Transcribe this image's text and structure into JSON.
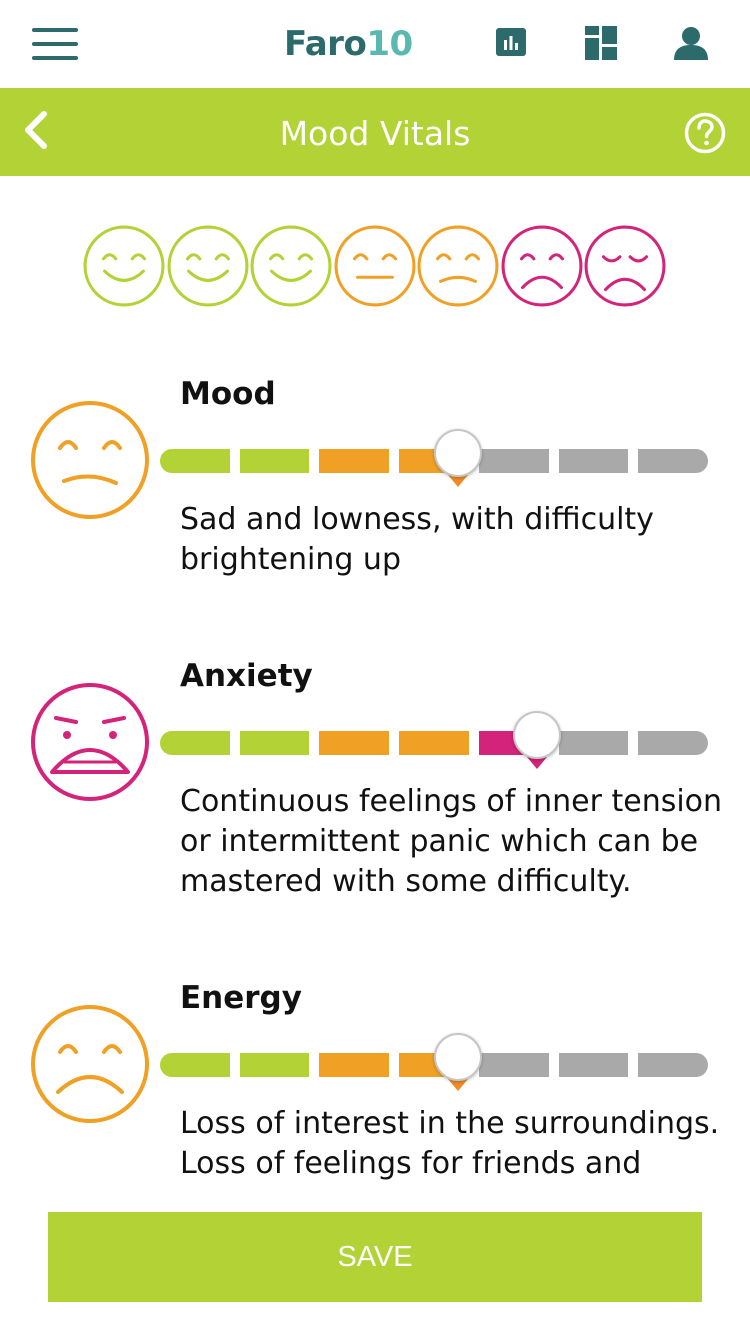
{
  "app": {
    "logo_part1": "Faro",
    "logo_part2": "10",
    "colors": {
      "brand_dark": "#2d6a6b",
      "brand_light": "#5ab8b1",
      "accent_green": "#b2d235",
      "orange": "#f0a024",
      "magenta": "#d4237a",
      "grey": "#a9a9a9"
    }
  },
  "header": {
    "menu_icon": "hamburger-menu-icon",
    "icons": [
      "bar-chart-icon",
      "dashboard-icon",
      "user-icon"
    ]
  },
  "titlebar": {
    "title": "Mood Vitals",
    "back_icon": "chevron-left-icon",
    "help_icon": "help-circle-icon"
  },
  "scale_faces": [
    {
      "kind": "smile",
      "color": "#b2d235"
    },
    {
      "kind": "smile",
      "color": "#b2d235"
    },
    {
      "kind": "smile",
      "color": "#b2d235"
    },
    {
      "kind": "neutral",
      "color": "#f0a024"
    },
    {
      "kind": "slight-sad",
      "color": "#f0a024"
    },
    {
      "kind": "sad",
      "color": "#d4237a"
    },
    {
      "kind": "very-sad",
      "color": "#d4237a"
    }
  ],
  "vitals": [
    {
      "label": "Mood",
      "level": 4,
      "of": 7,
      "face": "slight-sad-face-icon",
      "description": "Sad and lowness, with difficulty brightening up"
    },
    {
      "label": "Anxiety",
      "level": 5,
      "of": 7,
      "face": "anxious-face-icon",
      "description": "Continuous feelings of inner tension or intermittent panic which can be mastered with some difficulty."
    },
    {
      "label": "Energy",
      "level": 4,
      "of": 7,
      "face": "sad-face-icon",
      "description": "Loss of interest in the surroundings. Loss of feelings for friends and acquaintances."
    }
  ],
  "footer": {
    "save_label": "SAVE"
  }
}
